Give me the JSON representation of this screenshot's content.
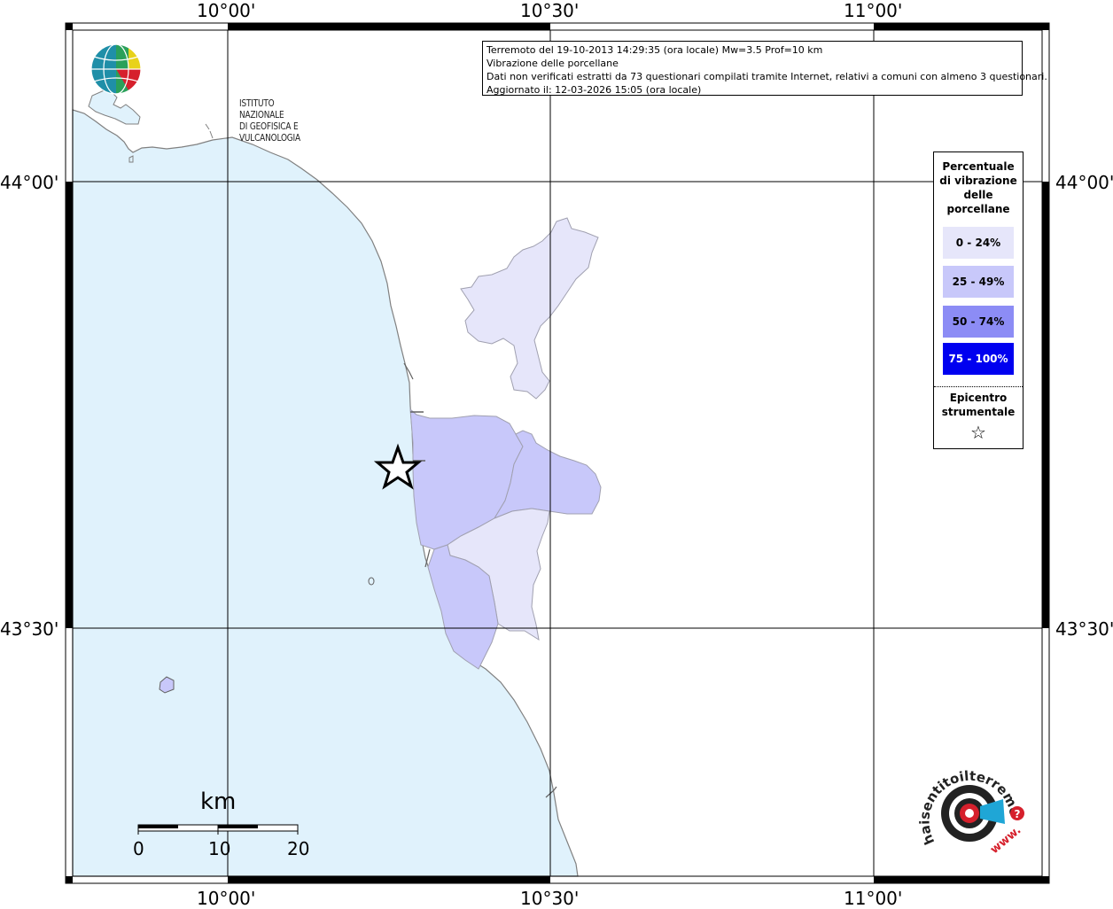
{
  "axes": {
    "top_labels": [
      "10°00'",
      "10°30'",
      "11°00'"
    ],
    "bottom_labels": [
      "10°00'",
      "10°30'",
      "11°00'"
    ],
    "left_labels": [
      "44°00'",
      "43°30'"
    ],
    "right_labels": [
      "44°00'",
      "43°30'"
    ]
  },
  "info": {
    "line1": "Terremoto del 19-10-2013 14:29:35 (ora locale) Mw=3.5 Prof=10 km",
    "line2": "Vibrazione delle porcellane",
    "line3": "Dati non verificati estratti da 73 questionari compilati tramite Internet, relativi a comuni con almeno 3 questionari.",
    "line4": "Aggiornato il: 12-03-2026 15:05 (ora locale)"
  },
  "legend": {
    "title": "Percentuale di vibrazione delle porcellane",
    "items": [
      {
        "label": "0 - 24%",
        "color": "#e6e6fa",
        "text_color": "#000000"
      },
      {
        "label": "25 - 49%",
        "color": "#c8c8fa",
        "text_color": "#000000"
      },
      {
        "label": "50 - 74%",
        "color": "#8c8cf5",
        "text_color": "#000000"
      },
      {
        "label": "75 - 100%",
        "color": "#0000f0",
        "text_color": "#ffffff"
      }
    ],
    "epicenter_label": "Epicentro strumentale",
    "epicenter_symbol": "☆"
  },
  "logo_ingv": {
    "line1": "ISTITUTO NAZIONALE",
    "line2": "DI GEOFISICA E VULCANOLOGIA"
  },
  "scale_bar": {
    "unit": "km",
    "ticks": [
      "0",
      "10",
      "20"
    ]
  },
  "logo_hst": {
    "text": "haisentitoilterremoto.it",
    "prefix": "www.",
    "question": "?"
  },
  "colors": {
    "sea": "#e0f2fc",
    "land": "#ffffff",
    "grid": "#000000",
    "coast": "#808080"
  }
}
